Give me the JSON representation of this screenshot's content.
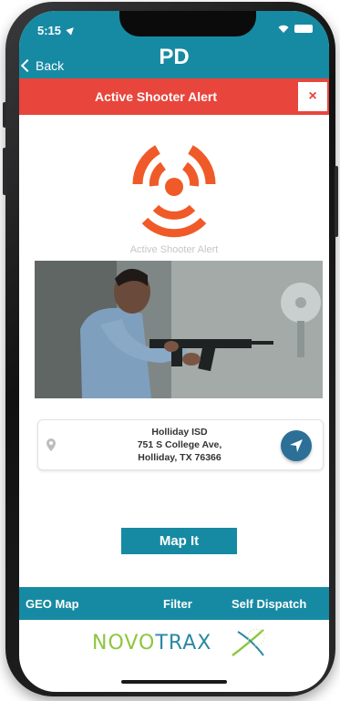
{
  "status_bar": {
    "time": "5:15",
    "location_icon": "location-arrow-icon",
    "wifi_icon": "wifi-icon",
    "battery_icon": "battery-icon"
  },
  "header": {
    "back_label": "Back",
    "title": "PD",
    "color": "#178aa3"
  },
  "alert": {
    "title": "Active Shooter Alert",
    "close_label": "×",
    "color": "#e8453c"
  },
  "alert_icon": {
    "icon": "alarm-signal-icon",
    "caption": "Active Shooter Alert",
    "color": "#f05a28"
  },
  "address": {
    "name": "Holliday ISD",
    "street": "751 S College Ave,",
    "city": "Holliday, TX 76366",
    "pin_icon": "map-pin-icon",
    "navigate_icon": "navigation-arrow-icon"
  },
  "actions": {
    "map_it_label": "Map It"
  },
  "toolbar": {
    "geo_map_label": "GEO Map",
    "filter_label": "Filter",
    "self_dispatch_label": "Self Dispatch"
  },
  "brand": {
    "part_a": "NOVO",
    "part_b": "TRAX"
  }
}
